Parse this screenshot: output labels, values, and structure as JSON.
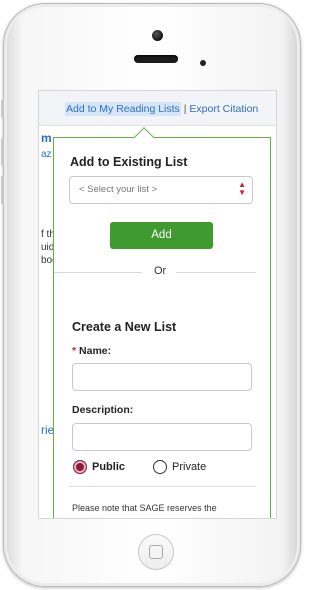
{
  "links": {
    "reading_lists": "Add to My Reading Lists",
    "separator": "|",
    "export_citation": "Export Citation"
  },
  "background_fragments": {
    "f1": "m",
    "f2": "az",
    "f3": "f th",
    "f4": "uid",
    "f5": "boo",
    "f6": "rie"
  },
  "popup": {
    "existing_title": "Add to Existing List",
    "select_placeholder": "< Select your list >",
    "add_label": "Add",
    "or_label": "Or",
    "new_title": "Create a New List",
    "required_mark": "*",
    "name_label": "Name:",
    "description_label": "Description:",
    "public_label": "Public",
    "private_label": "Private",
    "note_text": "Please note that SAGE reserves the"
  },
  "colors": {
    "accent_green": "#62b046",
    "button_green": "#3f9a30",
    "link_blue": "#2a6fc9",
    "radio_selected": "#8a1b39"
  }
}
